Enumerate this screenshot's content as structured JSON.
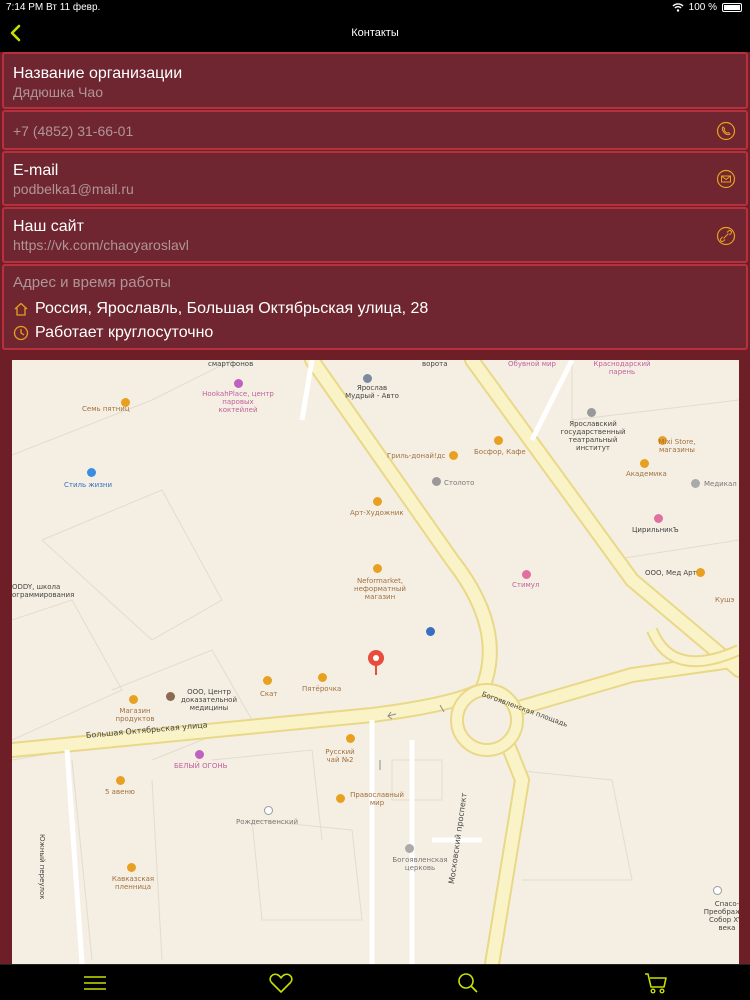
{
  "status": {
    "time": "7:14 PM",
    "date": "Вт 11 февр.",
    "battery": "100 %"
  },
  "nav": {
    "title": "Контакты",
    "back_icon": "chevron-left-icon"
  },
  "org": {
    "label": "Название организации",
    "value": "Дядюшка Чао"
  },
  "phone": {
    "value": "+7 (4852) 31-66-01",
    "icon": "phone-icon"
  },
  "email": {
    "label": "E-mail",
    "value": "podbelka1@mail.ru",
    "icon": "mail-icon"
  },
  "site": {
    "label": "Наш сайт",
    "value": "https://vk.com/chaoyaroslavl",
    "icon": "link-icon"
  },
  "address": {
    "label": "Адрес и время работы",
    "address": "Россия, Ярославль, Большая Октябрьская улица, 28",
    "hours": "Работает круглосуточно"
  },
  "map": {
    "labels": {
      "smartfon": "смартфонов",
      "hookah": "HookahPlace, центр паровых коктейлей",
      "sem": "Семь пятниц",
      "stil": "Стиль жизни",
      "buddy": "ODDY, школа ограммирования",
      "yaroslav": "Ярослав Мудрый - Авто",
      "gril": "Гриль-донай!дс",
      "bosfor": "Босфор, Кафе",
      "stoloto": "Столото",
      "art": "Арт-Художник",
      "neformat": "Neformarket, неформатный магазин",
      "stimul": "Стимул",
      "pyaterochka": "Пятёрочка",
      "skat": "Скат",
      "ooo_centr": "ООО, Центр доказательной медицины",
      "magaziny": "Магазин продуктов",
      "russkiy": "Русский чай №2",
      "pravoslav": "Православный мир",
      "beliy": "БЕЛЫЙ ОГОНЬ",
      "avenue": "5 авеню",
      "rozhd": "Рождественский",
      "bogoyav": "Богоявленская церковь",
      "kavkaz": "Кавказская пленница",
      "krasnodar": "Краснодарский парень",
      "theatre": "Ярославский государственный театральный институт",
      "mixi": "Mixi Store, магазины",
      "akad": "Академика",
      "medikal": "Медикал",
      "ciril": "ЦирильникЪ",
      "medart": "ООО, Мед Арт",
      "kush": "Кушэ",
      "spas": "Спасо-Преображен Собор XVI века",
      "street_bo": "Большая Октябрьская улица",
      "street_mp": "Московский проспект",
      "street_bp": "Богоявленская площадь",
      "street_yu": "Южный переулок",
      "shoe": "Обувной мир",
      "vorota": "ворота"
    }
  },
  "tabs": [
    {
      "name": "menu-icon"
    },
    {
      "name": "heart-icon"
    },
    {
      "name": "search-icon"
    },
    {
      "name": "cart-icon"
    }
  ],
  "colors": {
    "accent": "#c8e000",
    "card_bg": "#6f2630",
    "card_border": "#b6303e",
    "icon_gold": "#e8a020"
  }
}
